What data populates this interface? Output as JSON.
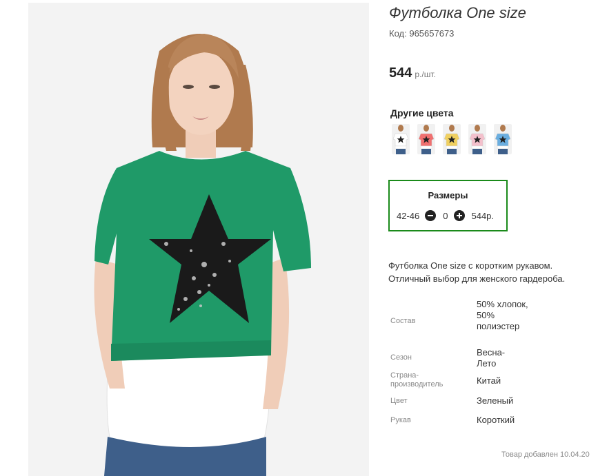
{
  "product": {
    "title": "Футболка One size",
    "code_label": "Код:",
    "code": "965657673",
    "price": "544",
    "price_unit": "р./шт."
  },
  "other_colors": {
    "title": "Другие цвета",
    "items": [
      {
        "color": "#ffffff"
      },
      {
        "color": "#f07070"
      },
      {
        "color": "#f0d060"
      },
      {
        "color": "#f4c0cc"
      },
      {
        "color": "#6aaee0"
      }
    ]
  },
  "sizes": {
    "title": "Размеры",
    "rows": [
      {
        "size": "42-46",
        "quantity": "0",
        "price": "544р."
      }
    ]
  },
  "description": "Футболка One size с коротким рукавом. Отличный выбор для женского гардероба.",
  "attributes": [
    {
      "key": "Состав",
      "value": "50% хлопок, 50% полиэстер"
    },
    {
      "key": "Сезон",
      "value": "Весна-Лето"
    },
    {
      "key": "Страна-производитель",
      "value": "Китай"
    },
    {
      "key": "Цвет",
      "value": "Зеленый"
    },
    {
      "key": "Рукав",
      "value": "Короткий"
    }
  ],
  "added": "Товар добавлен 10.04.20",
  "colors": {
    "shirt": "#1f9a68",
    "box_border": "#1a8a1a"
  }
}
